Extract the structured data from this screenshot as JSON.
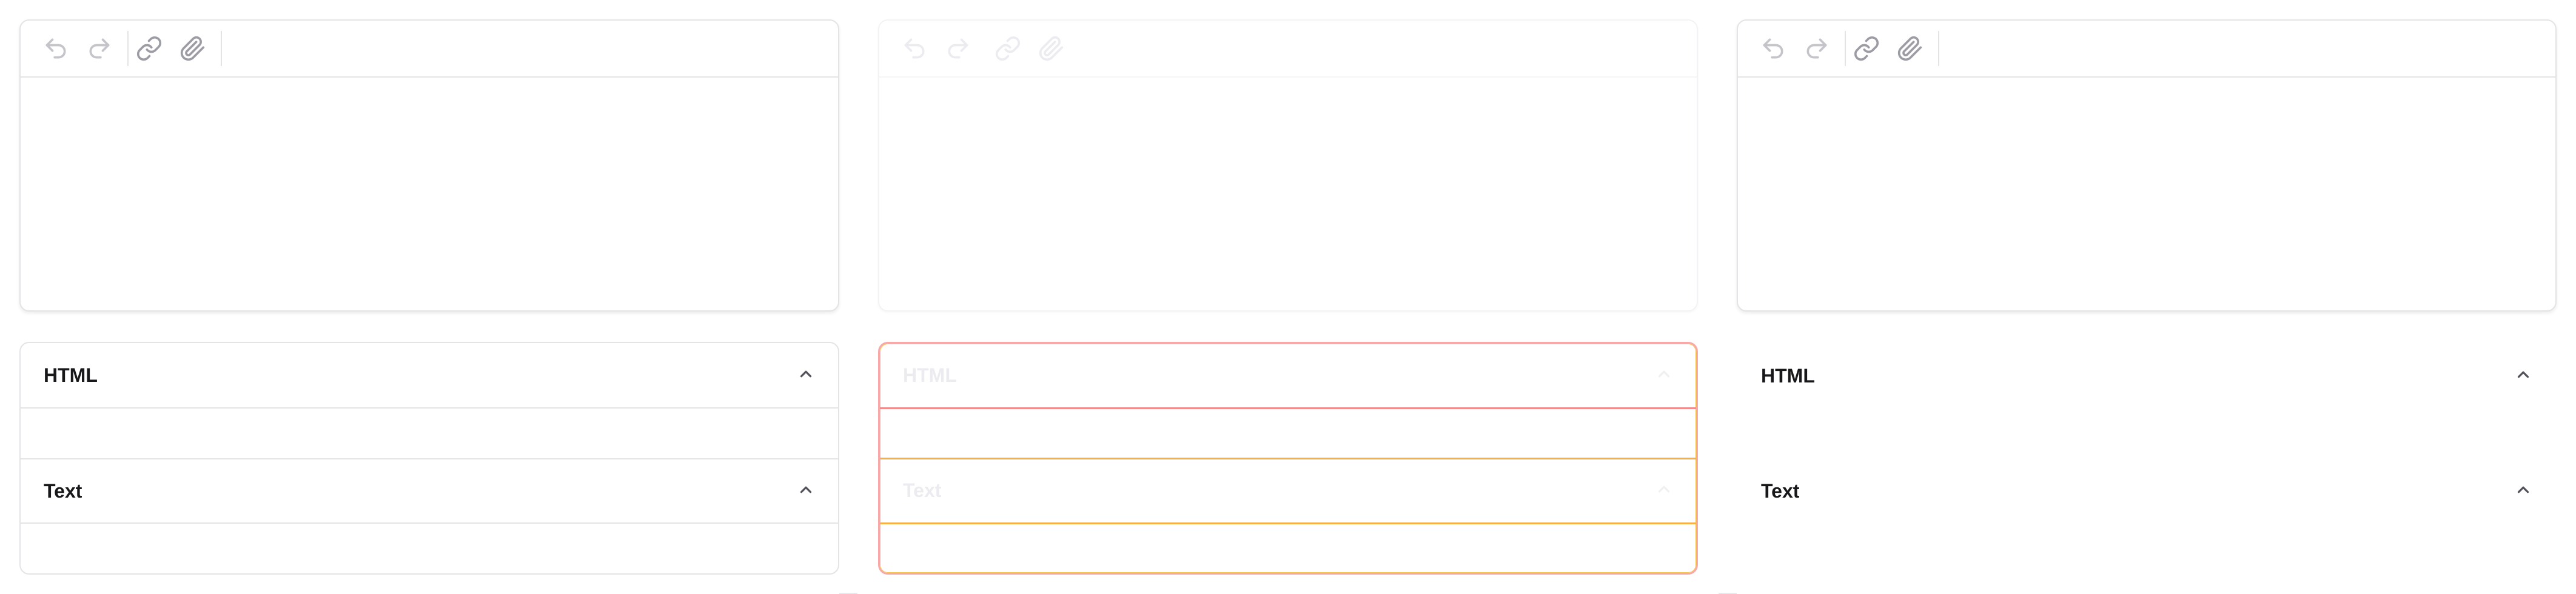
{
  "panels": [
    {
      "id": "default",
      "toolbar": [
        {
          "icon": "undo-icon",
          "disabled": true
        },
        {
          "icon": "redo-icon",
          "disabled": true
        },
        {
          "icon": "link-icon",
          "disabled": false
        },
        {
          "icon": "paperclip-icon",
          "disabled": false
        }
      ],
      "sections": [
        {
          "title": "HTML"
        },
        {
          "title": "Text"
        }
      ]
    },
    {
      "id": "disabled",
      "toolbar": [
        {
          "icon": "undo-icon",
          "disabled": true
        },
        {
          "icon": "redo-icon",
          "disabled": true
        },
        {
          "icon": "link-icon",
          "disabled": true
        },
        {
          "icon": "paperclip-icon",
          "disabled": true
        }
      ],
      "sections": [
        {
          "title": "HTML"
        },
        {
          "title": "Text"
        }
      ]
    },
    {
      "id": "borderless",
      "toolbar": [
        {
          "icon": "undo-icon",
          "disabled": true
        },
        {
          "icon": "redo-icon",
          "disabled": true
        },
        {
          "icon": "link-icon",
          "disabled": false
        },
        {
          "icon": "paperclip-icon",
          "disabled": false
        }
      ],
      "sections": [
        {
          "title": "HTML"
        },
        {
          "title": "Text"
        }
      ]
    }
  ],
  "colors": {
    "border": "#e4e4e7",
    "text": "#18181b",
    "icon": "#9c9ca4",
    "error_border": "#f28b8b",
    "warning_border": "#f6b04a"
  }
}
